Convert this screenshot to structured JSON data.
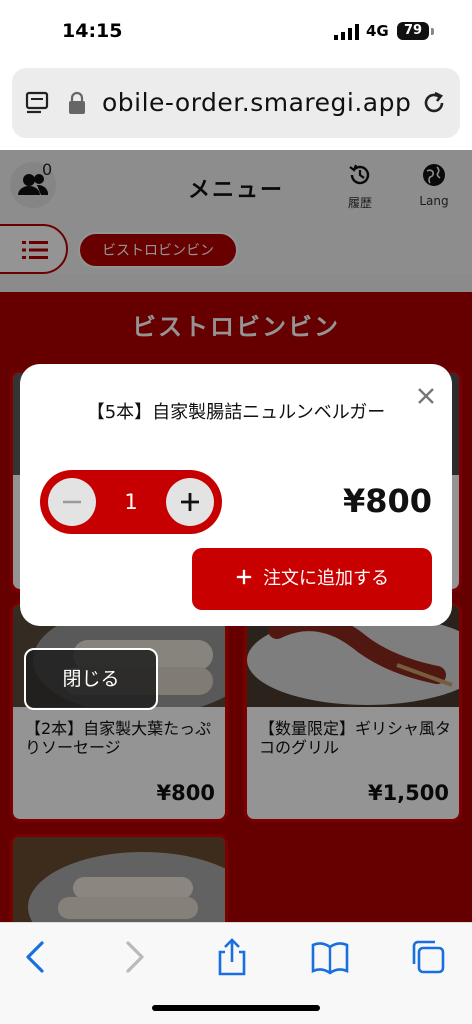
{
  "status": {
    "time": "14:15",
    "network": "4G",
    "battery": "79"
  },
  "browser": {
    "url": "obile-order.smaregi.app"
  },
  "header": {
    "title": "メニュー",
    "cart_count": "0",
    "history_label": "履歴",
    "lang_label": "Lang"
  },
  "category": {
    "chip": "ビストロビンビン",
    "section_title": "ビストロビンビン"
  },
  "cards": [
    {
      "name": "【2本】自家製大葉たっぷりソーセージ",
      "price": "¥800"
    },
    {
      "name": "【数量限定】ギリシャ風タコのグリル",
      "price": "¥1,500"
    }
  ],
  "modal": {
    "title": "【5本】自家製腸詰ニュルンベルガー",
    "quantity": "1",
    "price": "¥800",
    "add_button": "注文に追加する"
  },
  "close_button": "閉じる",
  "colors": {
    "accent": "#c90000",
    "banner": "#b00000"
  }
}
